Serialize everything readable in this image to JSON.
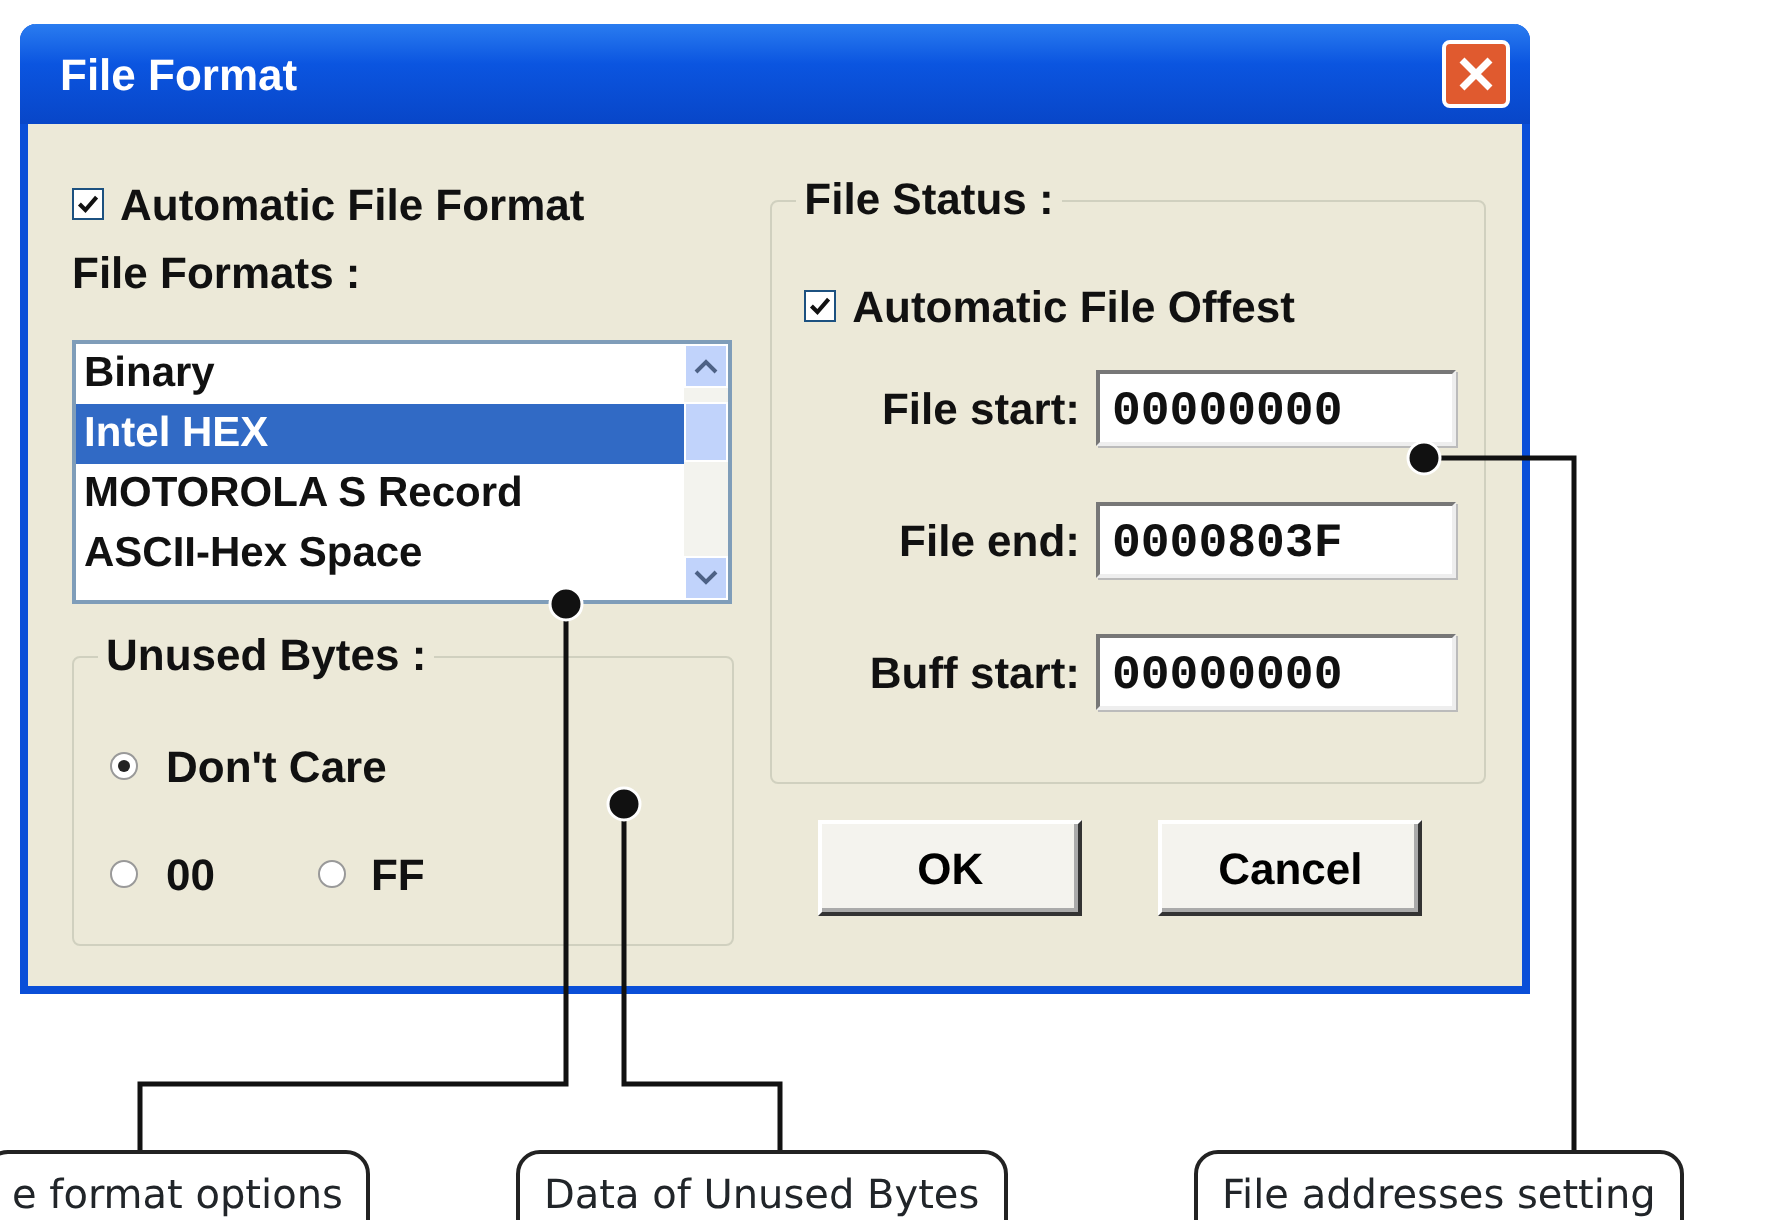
{
  "window": {
    "title": "File Format"
  },
  "auto_format": {
    "label": "Automatic File Format",
    "checked": true
  },
  "formats": {
    "label": "File Formats :",
    "items": [
      {
        "label": "Binary",
        "selected": false
      },
      {
        "label": "Intel HEX",
        "selected": true
      },
      {
        "label": "MOTOROLA S Record",
        "selected": false
      },
      {
        "label": "ASCII-Hex Space",
        "selected": false
      }
    ]
  },
  "unused_bytes": {
    "title": "Unused Bytes :",
    "options": [
      {
        "label": "Don't Care",
        "selected": true
      },
      {
        "label": "00",
        "selected": false
      },
      {
        "label": "FF",
        "selected": false
      }
    ]
  },
  "file_status": {
    "title": "File Status :",
    "auto_offset": {
      "label": "Automatic File Offest",
      "checked": true
    },
    "fields": [
      {
        "label": "File start:",
        "value": "00000000"
      },
      {
        "label": "File end:",
        "value": "0000803F"
      },
      {
        "label": "Buff start:",
        "value": "00000000"
      }
    ]
  },
  "buttons": [
    "OK",
    "Cancel"
  ],
  "callouts": [
    "e format options",
    "Data of Unused Bytes",
    "File addresses setting"
  ]
}
